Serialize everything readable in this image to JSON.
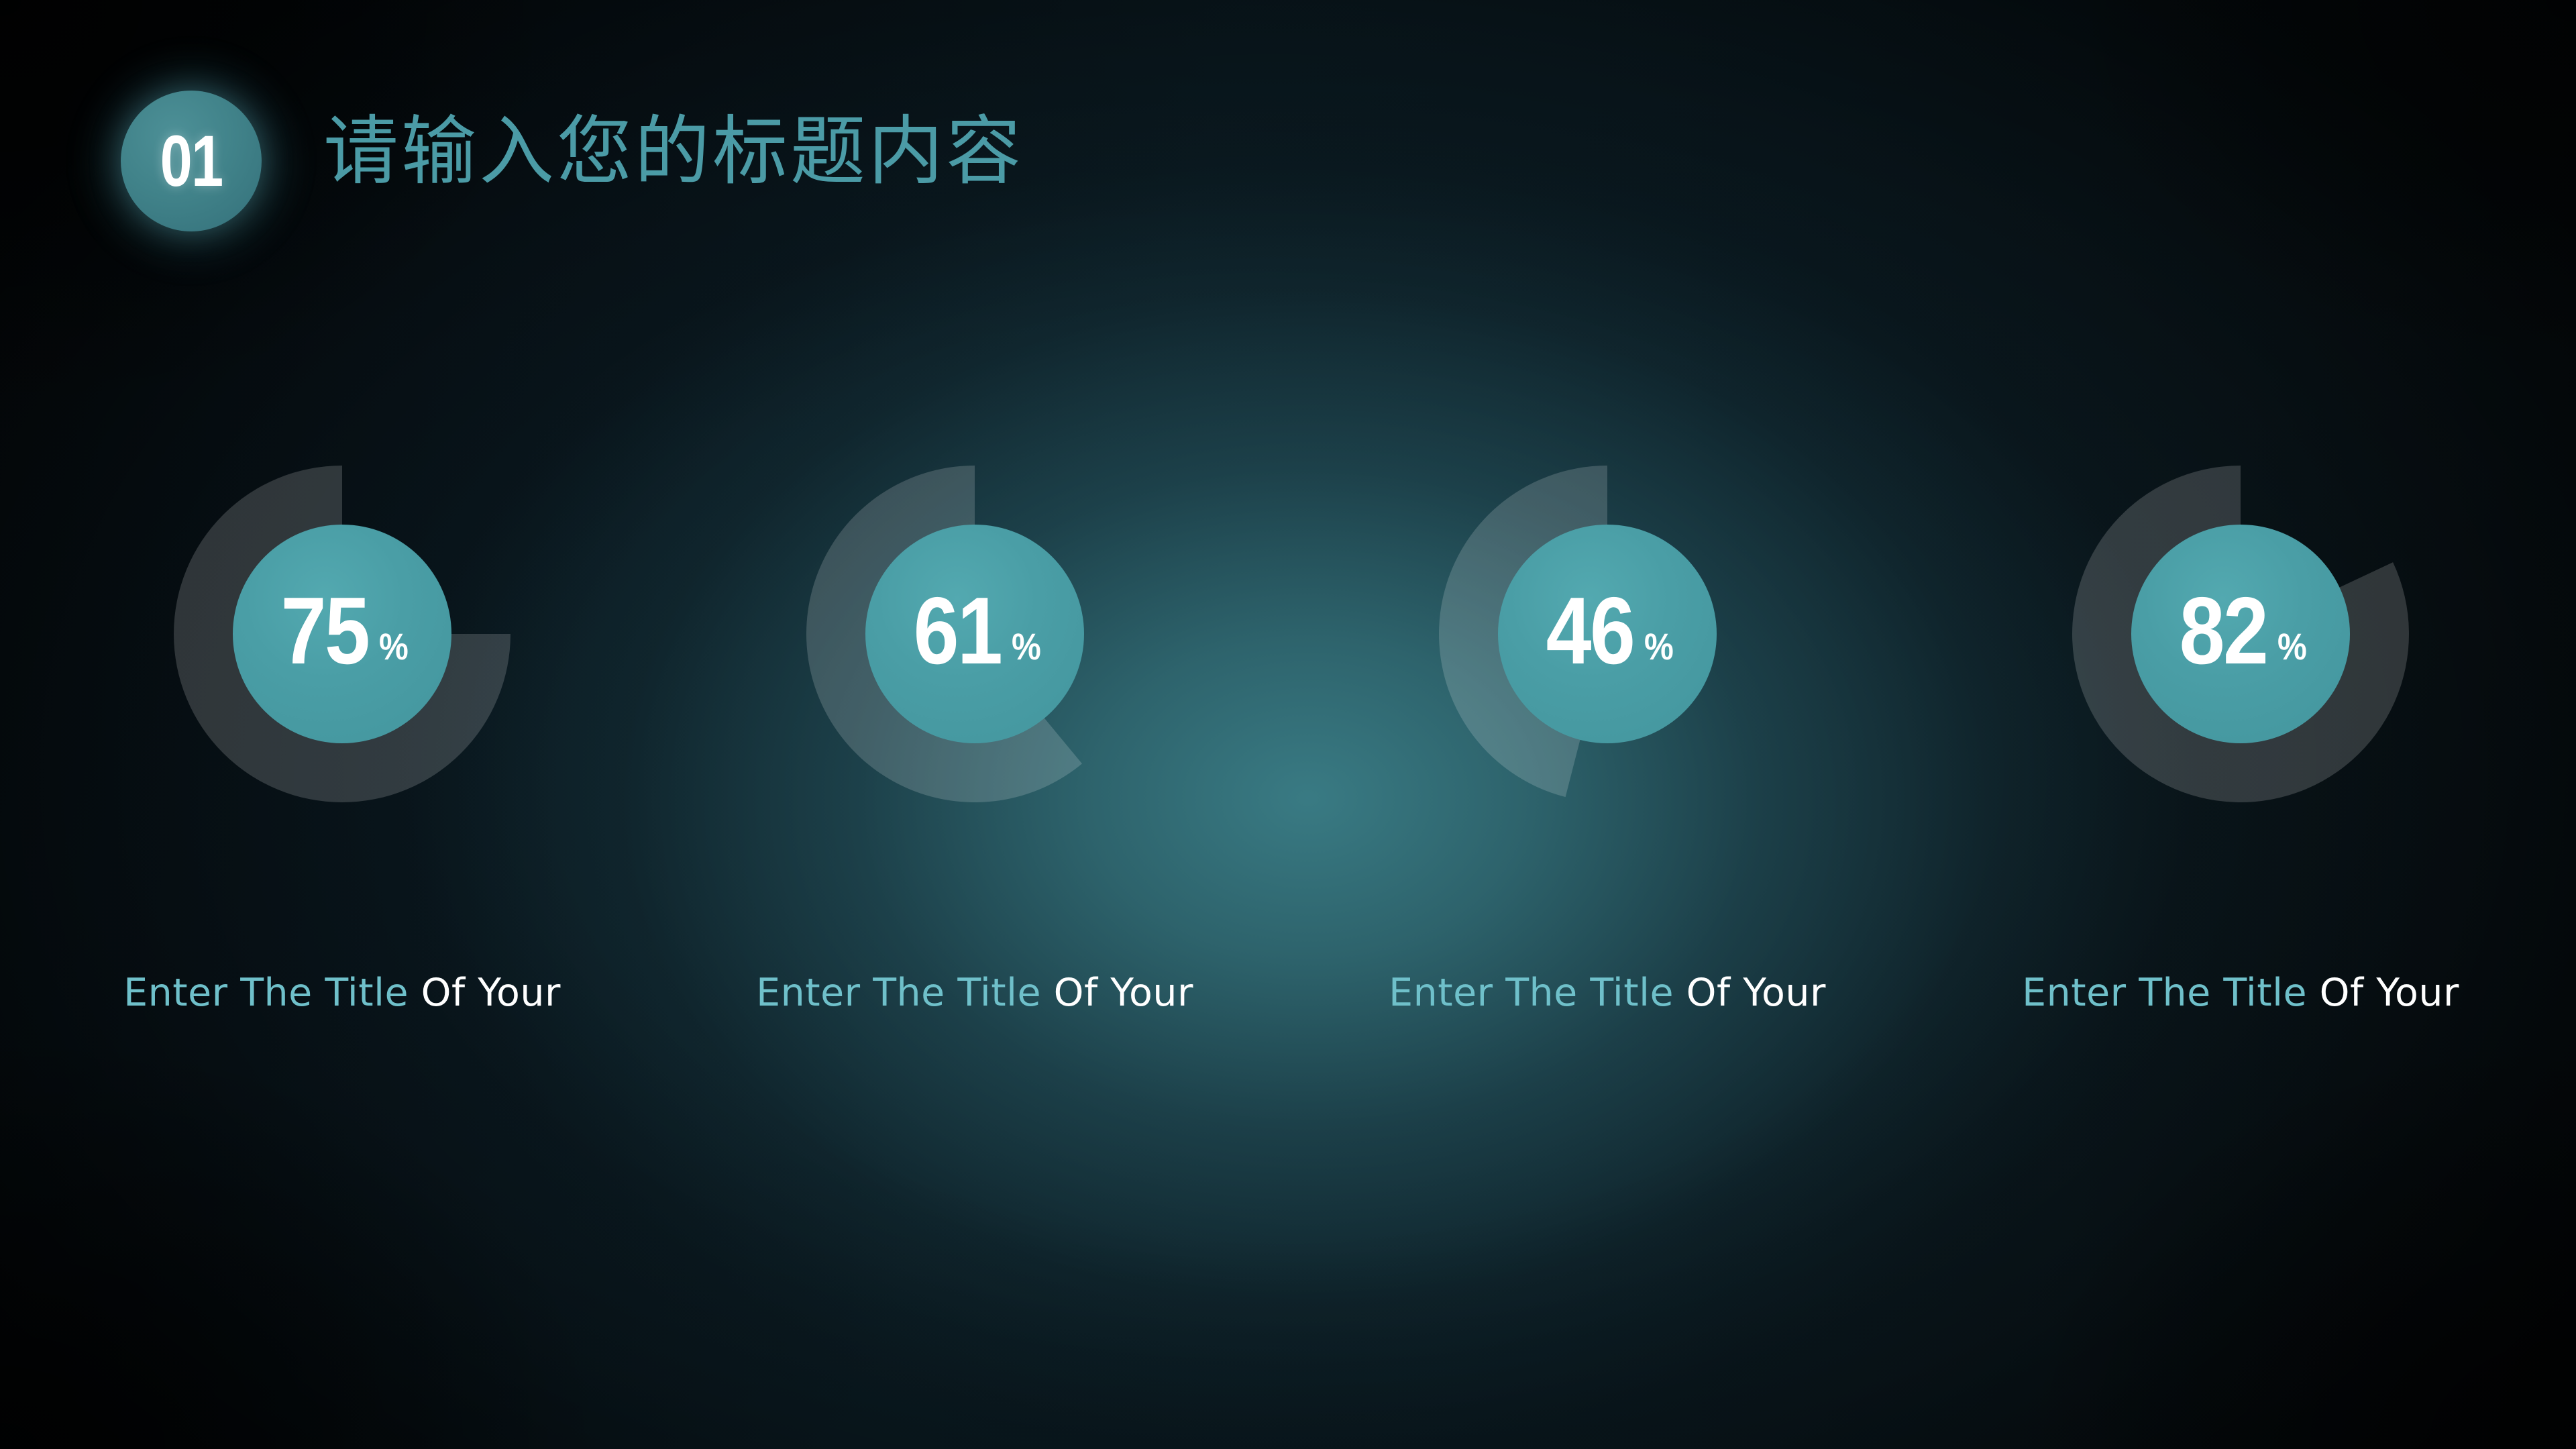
{
  "header": {
    "badge_number": "01",
    "title": "请输入您的标题内容"
  },
  "theme": {
    "accent_teal": "#4a9ea6",
    "caption_teal": "#6fc0ca",
    "title_teal": "#4b9ba6",
    "badge_teal": "#41838a",
    "value_text": "#ffffff",
    "background_dark": "#0a1418",
    "ring_track": "rgba(255,255,255,0.17)"
  },
  "chart_data": {
    "type": "pie",
    "title": "请输入您的标题内容",
    "unit": "%",
    "layout": "four donut gauges in a row, arcs sweep counter-clockwise from 12 o'clock",
    "categories": [
      "Enter The Title Of Your",
      "Enter The Title Of Your",
      "Enter The Title Of Your",
      "Enter The Title Of Your"
    ],
    "values": [
      75,
      61,
      46,
      82
    ],
    "ylim": [
      0,
      100
    ],
    "grid": false,
    "legend": "none"
  },
  "gauges": [
    {
      "value": "75",
      "percent_symbol": "%",
      "numeric": 75,
      "caption_primary": "Enter The Title",
      "caption_secondary": "Of Your"
    },
    {
      "value": "61",
      "percent_symbol": "%",
      "numeric": 61,
      "caption_primary": "Enter The Title",
      "caption_secondary": "Of Your"
    },
    {
      "value": "46",
      "percent_symbol": "%",
      "numeric": 46,
      "caption_primary": "Enter The Title",
      "caption_secondary": "Of Your"
    },
    {
      "value": "82",
      "percent_symbol": "%",
      "numeric": 82,
      "caption_primary": "Enter The Title",
      "caption_secondary": "Of Your"
    }
  ]
}
